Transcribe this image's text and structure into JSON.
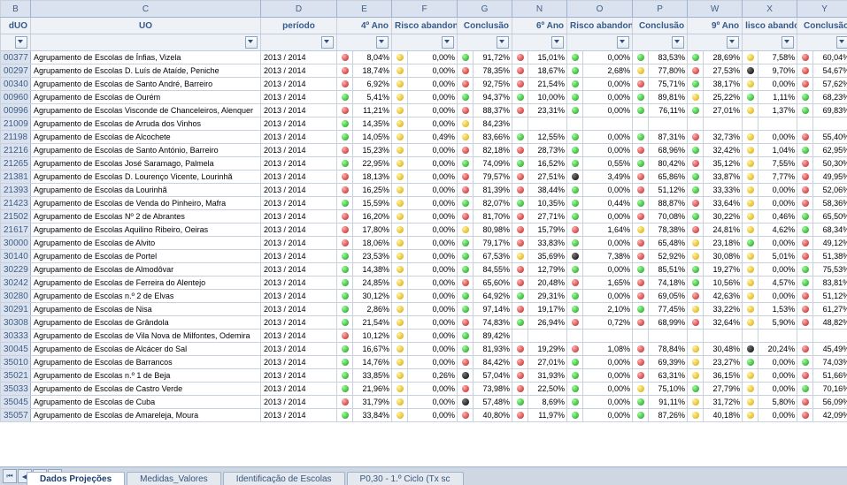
{
  "columns": {
    "B": "B",
    "C": "C",
    "D": "D",
    "E": "E",
    "F": "F",
    "G": "G",
    "N": "N",
    "O": "O",
    "P": "P",
    "W": "W",
    "X": "X",
    "Y": "Y"
  },
  "header1": {
    "B": "dUO",
    "C": "UO",
    "D": "período",
    "E": "4º Ano",
    "F": "Risco abandono",
    "G": "Conclusão",
    "N": "6º Ano",
    "O": "Risco abandono",
    "P": "Conclusão",
    "W": "9º Ano",
    "X": "lisco abandon",
    "Y": "Conclusão"
  },
  "rows": [
    {
      "id": "00377",
      "uo": "Agrupamento de Escolas de Ínfias, Vizela",
      "per": "2013 / 2014",
      "eI": "r",
      "e": "8,04%",
      "fI": "y",
      "f": "0,00%",
      "gI": "g",
      "g": "91,72%",
      "nI": "r",
      "n": "15,01%",
      "oI": "g",
      "o": "0,00%",
      "pI": "g",
      "p": "83,53%",
      "wI": "g",
      "w": "28,69%",
      "xI": "y",
      "x": "7,58%",
      "yI": "r",
      "y": "60,04%"
    },
    {
      "id": "00297",
      "uo": "Agrupamento de Escolas D. Luís de Ataíde, Peniche",
      "per": "2013 / 2014",
      "eI": "r",
      "e": "18,74%",
      "fI": "y",
      "f": "0,00%",
      "gI": "r",
      "g": "78,35%",
      "nI": "r",
      "n": "18,67%",
      "oI": "g",
      "o": "2,68%",
      "pI": "y",
      "p": "77,80%",
      "wI": "r",
      "w": "27,53%",
      "xI": "k",
      "x": "9,70%",
      "yI": "r",
      "y": "54,67%"
    },
    {
      "id": "00340",
      "uo": "Agrupamento de Escolas de Santo André, Barreiro",
      "per": "2013 / 2014",
      "eI": "r",
      "e": "6,92%",
      "fI": "y",
      "f": "0,00%",
      "gI": "r",
      "g": "92,75%",
      "nI": "r",
      "n": "21,54%",
      "oI": "g",
      "o": "0,00%",
      "pI": "r",
      "p": "75,71%",
      "wI": "g",
      "w": "38,17%",
      "xI": "y",
      "x": "0,00%",
      "yI": "r",
      "y": "57,62%"
    },
    {
      "id": "00960",
      "uo": "Agrupamento de Escolas de Ourém",
      "per": "2013 / 2014",
      "eI": "g",
      "e": "5,41%",
      "fI": "y",
      "f": "0,00%",
      "gI": "g",
      "g": "94,37%",
      "nI": "g",
      "n": "10,00%",
      "oI": "g",
      "o": "0,00%",
      "pI": "g",
      "p": "89,81%",
      "wI": "y",
      "w": "25,22%",
      "xI": "g",
      "x": "1,11%",
      "yI": "g",
      "y": "68,23%"
    },
    {
      "id": "00996",
      "uo": "Agrupamento de Escolas Visconde de Chanceleiros, Alenquer",
      "per": "2013 / 2014",
      "eI": "r",
      "e": "11,21%",
      "fI": "y",
      "f": "0,00%",
      "gI": "r",
      "g": "88,37%",
      "nI": "r",
      "n": "23,31%",
      "oI": "g",
      "o": "0,00%",
      "pI": "g",
      "p": "76,11%",
      "wI": "g",
      "w": "27,01%",
      "xI": "y",
      "x": "1,37%",
      "yI": "g",
      "y": "69,83%"
    },
    {
      "id": "21009",
      "uo": "Agrupamento de Escolas de Arruda dos Vinhos",
      "per": "2013 / 2014",
      "eI": "g",
      "e": "14,35%",
      "fI": "y",
      "f": "0,00%",
      "gI": "y",
      "g": "84,23%",
      "nI": "",
      "n": "",
      "oI": "",
      "o": "",
      "pI": "",
      "p": "",
      "wI": "",
      "w": "",
      "xI": "",
      "x": "",
      "yI": "",
      "y": ""
    },
    {
      "id": "21198",
      "uo": "Agrupamento de Escolas de Alcochete",
      "per": "2013 / 2014",
      "eI": "g",
      "e": "14,05%",
      "fI": "y",
      "f": "0,49%",
      "gI": "y",
      "g": "83,66%",
      "nI": "g",
      "n": "12,55%",
      "oI": "g",
      "o": "0,00%",
      "pI": "g",
      "p": "87,31%",
      "wI": "r",
      "w": "32,73%",
      "xI": "y",
      "x": "0,00%",
      "yI": "r",
      "y": "55,40%"
    },
    {
      "id": "21216",
      "uo": "Agrupamento de Escolas de Santo António, Barreiro",
      "per": "2013 / 2014",
      "eI": "r",
      "e": "15,23%",
      "fI": "y",
      "f": "0,00%",
      "gI": "r",
      "g": "82,18%",
      "nI": "r",
      "n": "28,73%",
      "oI": "g",
      "o": "0,00%",
      "pI": "r",
      "p": "68,96%",
      "wI": "g",
      "w": "32,42%",
      "xI": "y",
      "x": "1,04%",
      "yI": "g",
      "y": "62,95%"
    },
    {
      "id": "21265",
      "uo": "Agrupamento de Escolas José Saramago, Palmela",
      "per": "2013 / 2014",
      "eI": "g",
      "e": "22,95%",
      "fI": "y",
      "f": "0,00%",
      "gI": "g",
      "g": "74,09%",
      "nI": "g",
      "n": "16,52%",
      "oI": "g",
      "o": "0,55%",
      "pI": "g",
      "p": "80,42%",
      "wI": "r",
      "w": "35,12%",
      "xI": "y",
      "x": "7,55%",
      "yI": "r",
      "y": "50,30%"
    },
    {
      "id": "21381",
      "uo": "Agrupamento de Escolas D. Lourenço Vicente, Lourinhã",
      "per": "2013 / 2014",
      "eI": "r",
      "e": "18,13%",
      "fI": "y",
      "f": "0,00%",
      "gI": "r",
      "g": "79,57%",
      "nI": "r",
      "n": "27,51%",
      "oI": "k",
      "o": "3,49%",
      "pI": "r",
      "p": "65,86%",
      "wI": "g",
      "w": "33,87%",
      "xI": "y",
      "x": "7,77%",
      "yI": "r",
      "y": "49,95%"
    },
    {
      "id": "21393",
      "uo": "Agrupamento de Escolas da Lourinhã",
      "per": "2013 / 2014",
      "eI": "r",
      "e": "16,25%",
      "fI": "y",
      "f": "0,00%",
      "gI": "r",
      "g": "81,39%",
      "nI": "r",
      "n": "38,44%",
      "oI": "g",
      "o": "0,00%",
      "pI": "r",
      "p": "51,12%",
      "wI": "g",
      "w": "33,33%",
      "xI": "y",
      "x": "0,00%",
      "yI": "r",
      "y": "52,06%"
    },
    {
      "id": "21423",
      "uo": "Agrupamento de Escolas de Venda do Pinheiro, Mafra",
      "per": "2013 / 2014",
      "eI": "g",
      "e": "15,59%",
      "fI": "y",
      "f": "0,00%",
      "gI": "g",
      "g": "82,07%",
      "nI": "g",
      "n": "10,35%",
      "oI": "g",
      "o": "0,44%",
      "pI": "g",
      "p": "88,87%",
      "wI": "r",
      "w": "33,64%",
      "xI": "y",
      "x": "0,00%",
      "yI": "r",
      "y": "58,36%"
    },
    {
      "id": "21502",
      "uo": "Agrupamento de Escolas Nº 2 de Abrantes",
      "per": "2013 / 2014",
      "eI": "r",
      "e": "16,20%",
      "fI": "y",
      "f": "0,00%",
      "gI": "r",
      "g": "81,70%",
      "nI": "r",
      "n": "27,71%",
      "oI": "g",
      "o": "0,00%",
      "pI": "r",
      "p": "70,08%",
      "wI": "g",
      "w": "30,22%",
      "xI": "y",
      "x": "0,46%",
      "yI": "g",
      "y": "65,50%"
    },
    {
      "id": "21617",
      "uo": "Agrupamento de Escolas Aquilino Ribeiro, Oeiras",
      "per": "2013 / 2014",
      "eI": "r",
      "e": "17,80%",
      "fI": "y",
      "f": "0,00%",
      "gI": "y",
      "g": "80,98%",
      "nI": "r",
      "n": "15,79%",
      "oI": "r",
      "o": "1,64%",
      "pI": "y",
      "p": "78,38%",
      "wI": "r",
      "w": "24,81%",
      "xI": "y",
      "x": "4,62%",
      "yI": "g",
      "y": "68,34%"
    },
    {
      "id": "30000",
      "uo": "Agrupamento de Escolas de Alvito",
      "per": "2013 / 2014",
      "eI": "r",
      "e": "18,06%",
      "fI": "y",
      "f": "0,00%",
      "gI": "g",
      "g": "79,17%",
      "nI": "r",
      "n": "33,83%",
      "oI": "g",
      "o": "0,00%",
      "pI": "r",
      "p": "65,48%",
      "wI": "y",
      "w": "23,18%",
      "xI": "g",
      "x": "0,00%",
      "yI": "r",
      "y": "49,12%"
    },
    {
      "id": "30140",
      "uo": "Agrupamento de Escolas de Portel",
      "per": "2013 / 2014",
      "eI": "g",
      "e": "23,53%",
      "fI": "y",
      "f": "0,00%",
      "gI": "g",
      "g": "67,53%",
      "nI": "y",
      "n": "35,69%",
      "oI": "k",
      "o": "7,38%",
      "pI": "r",
      "p": "52,92%",
      "wI": "y",
      "w": "30,08%",
      "xI": "y",
      "x": "5,01%",
      "yI": "r",
      "y": "51,38%"
    },
    {
      "id": "30229",
      "uo": "Agrupamento de Escolas de Almodôvar",
      "per": "2013 / 2014",
      "eI": "g",
      "e": "14,38%",
      "fI": "y",
      "f": "0,00%",
      "gI": "g",
      "g": "84,55%",
      "nI": "r",
      "n": "12,79%",
      "oI": "g",
      "o": "0,00%",
      "pI": "g",
      "p": "85,51%",
      "wI": "g",
      "w": "19,27%",
      "xI": "y",
      "x": "0,00%",
      "yI": "g",
      "y": "75,53%"
    },
    {
      "id": "30242",
      "uo": "Agrupamento de Escolas de Ferreira do Alentejo",
      "per": "2013 / 2014",
      "eI": "g",
      "e": "24,85%",
      "fI": "y",
      "f": "0,00%",
      "gI": "r",
      "g": "65,60%",
      "nI": "r",
      "n": "20,48%",
      "oI": "r",
      "o": "1,65%",
      "pI": "r",
      "p": "74,18%",
      "wI": "g",
      "w": "10,56%",
      "xI": "y",
      "x": "4,57%",
      "yI": "g",
      "y": "83,81%"
    },
    {
      "id": "30280",
      "uo": "Agrupamento de Escolas n.º 2 de Elvas",
      "per": "2013 / 2014",
      "eI": "g",
      "e": "30,12%",
      "fI": "y",
      "f": "0,00%",
      "gI": "g",
      "g": "64,92%",
      "nI": "g",
      "n": "29,31%",
      "oI": "g",
      "o": "0,00%",
      "pI": "r",
      "p": "69,05%",
      "wI": "r",
      "w": "42,63%",
      "xI": "y",
      "x": "0,00%",
      "yI": "r",
      "y": "51,12%"
    },
    {
      "id": "30291",
      "uo": "Agrupamento de Escolas de Nisa",
      "per": "2013 / 2014",
      "eI": "g",
      "e": "2,86%",
      "fI": "y",
      "f": "0,00%",
      "gI": "g",
      "g": "97,14%",
      "nI": "r",
      "n": "19,17%",
      "oI": "g",
      "o": "2,10%",
      "pI": "g",
      "p": "77,45%",
      "wI": "y",
      "w": "33,22%",
      "xI": "y",
      "x": "1,53%",
      "yI": "r",
      "y": "61,27%"
    },
    {
      "id": "30308",
      "uo": "Agrupamento de Escolas de Grândola",
      "per": "2013 / 2014",
      "eI": "g",
      "e": "21,54%",
      "fI": "y",
      "f": "0,00%",
      "gI": "r",
      "g": "74,83%",
      "nI": "g",
      "n": "26,94%",
      "oI": "r",
      "o": "0,72%",
      "pI": "r",
      "p": "68,99%",
      "wI": "r",
      "w": "32,64%",
      "xI": "y",
      "x": "5,90%",
      "yI": "r",
      "y": "48,82%"
    },
    {
      "id": "30333",
      "uo": "Agrupamento de Escolas de Vila Nova de Milfontes, Odemira",
      "per": "2013 / 2014",
      "eI": "r",
      "e": "10,12%",
      "fI": "y",
      "f": "0,00%",
      "gI": "g",
      "g": "89,42%",
      "nI": "",
      "n": "",
      "oI": "",
      "o": "",
      "pI": "",
      "p": "",
      "wI": "",
      "w": "",
      "xI": "",
      "x": "",
      "yI": "",
      "y": ""
    },
    {
      "id": "30045",
      "uo": "Agrupamento de Escolas de Alcácer do Sal",
      "per": "2013 / 2014",
      "eI": "g",
      "e": "16,67%",
      "fI": "y",
      "f": "0,00%",
      "gI": "g",
      "g": "81,93%",
      "nI": "r",
      "n": "19,29%",
      "oI": "r",
      "o": "1,08%",
      "pI": "r",
      "p": "78,84%",
      "wI": "y",
      "w": "30,48%",
      "xI": "k",
      "x": "20,24%",
      "yI": "r",
      "y": "45,49%"
    },
    {
      "id": "35010",
      "uo": "Agrupamento de Escolas de Barrancos",
      "per": "2013 / 2014",
      "eI": "g",
      "e": "14,76%",
      "fI": "y",
      "f": "0,00%",
      "gI": "r",
      "g": "84,42%",
      "nI": "r",
      "n": "27,01%",
      "oI": "g",
      "o": "0,00%",
      "pI": "r",
      "p": "69,39%",
      "wI": "y",
      "w": "23,27%",
      "xI": "g",
      "x": "0,00%",
      "yI": "g",
      "y": "74,03%"
    },
    {
      "id": "35021",
      "uo": "Agrupamento de Escolas n.º 1 de Beja",
      "per": "2013 / 2014",
      "eI": "g",
      "e": "33,85%",
      "fI": "y",
      "f": "0,26%",
      "gI": "k",
      "g": "57,04%",
      "nI": "r",
      "n": "31,93%",
      "oI": "g",
      "o": "0,00%",
      "pI": "r",
      "p": "63,31%",
      "wI": "y",
      "w": "36,15%",
      "xI": "y",
      "x": "0,00%",
      "yI": "r",
      "y": "51,66%"
    },
    {
      "id": "35033",
      "uo": "Agrupamento de Escolas de Castro Verde",
      "per": "2013 / 2014",
      "eI": "g",
      "e": "21,96%",
      "fI": "y",
      "f": "0,00%",
      "gI": "r",
      "g": "73,98%",
      "nI": "r",
      "n": "22,50%",
      "oI": "g",
      "o": "0,00%",
      "pI": "y",
      "p": "75,10%",
      "wI": "g",
      "w": "27,79%",
      "xI": "y",
      "x": "0,00%",
      "yI": "g",
      "y": "70,16%"
    },
    {
      "id": "35045",
      "uo": "Agrupamento de Escolas de Cuba",
      "per": "2013 / 2014",
      "eI": "r",
      "e": "31,79%",
      "fI": "y",
      "f": "0,00%",
      "gI": "k",
      "g": "57,48%",
      "nI": "g",
      "n": "8,69%",
      "oI": "g",
      "o": "0,00%",
      "pI": "g",
      "p": "91,11%",
      "wI": "y",
      "w": "31,72%",
      "xI": "y",
      "x": "5,80%",
      "yI": "r",
      "y": "56,09%"
    },
    {
      "id": "35057",
      "uo": "Agrupamento de Escolas de Amareleja, Moura",
      "per": "2013 / 2014",
      "eI": "g",
      "e": "33,84%",
      "fI": "y",
      "f": "0,00%",
      "gI": "r",
      "g": "40,80%",
      "nI": "r",
      "n": "11,97%",
      "oI": "g",
      "o": "0,00%",
      "pI": "g",
      "p": "87,26%",
      "wI": "y",
      "w": "40,18%",
      "xI": "y",
      "x": "0,00%",
      "yI": "r",
      "y": "42,09%"
    }
  ],
  "tabs": [
    {
      "label": "Dados Projeções",
      "active": true
    },
    {
      "label": "Medidas_Valores",
      "active": false
    },
    {
      "label": "Identificação de Escolas",
      "active": false
    },
    {
      "label": "P0,30 - 1.º Ciclo (Tx sc",
      "active": false
    }
  ]
}
